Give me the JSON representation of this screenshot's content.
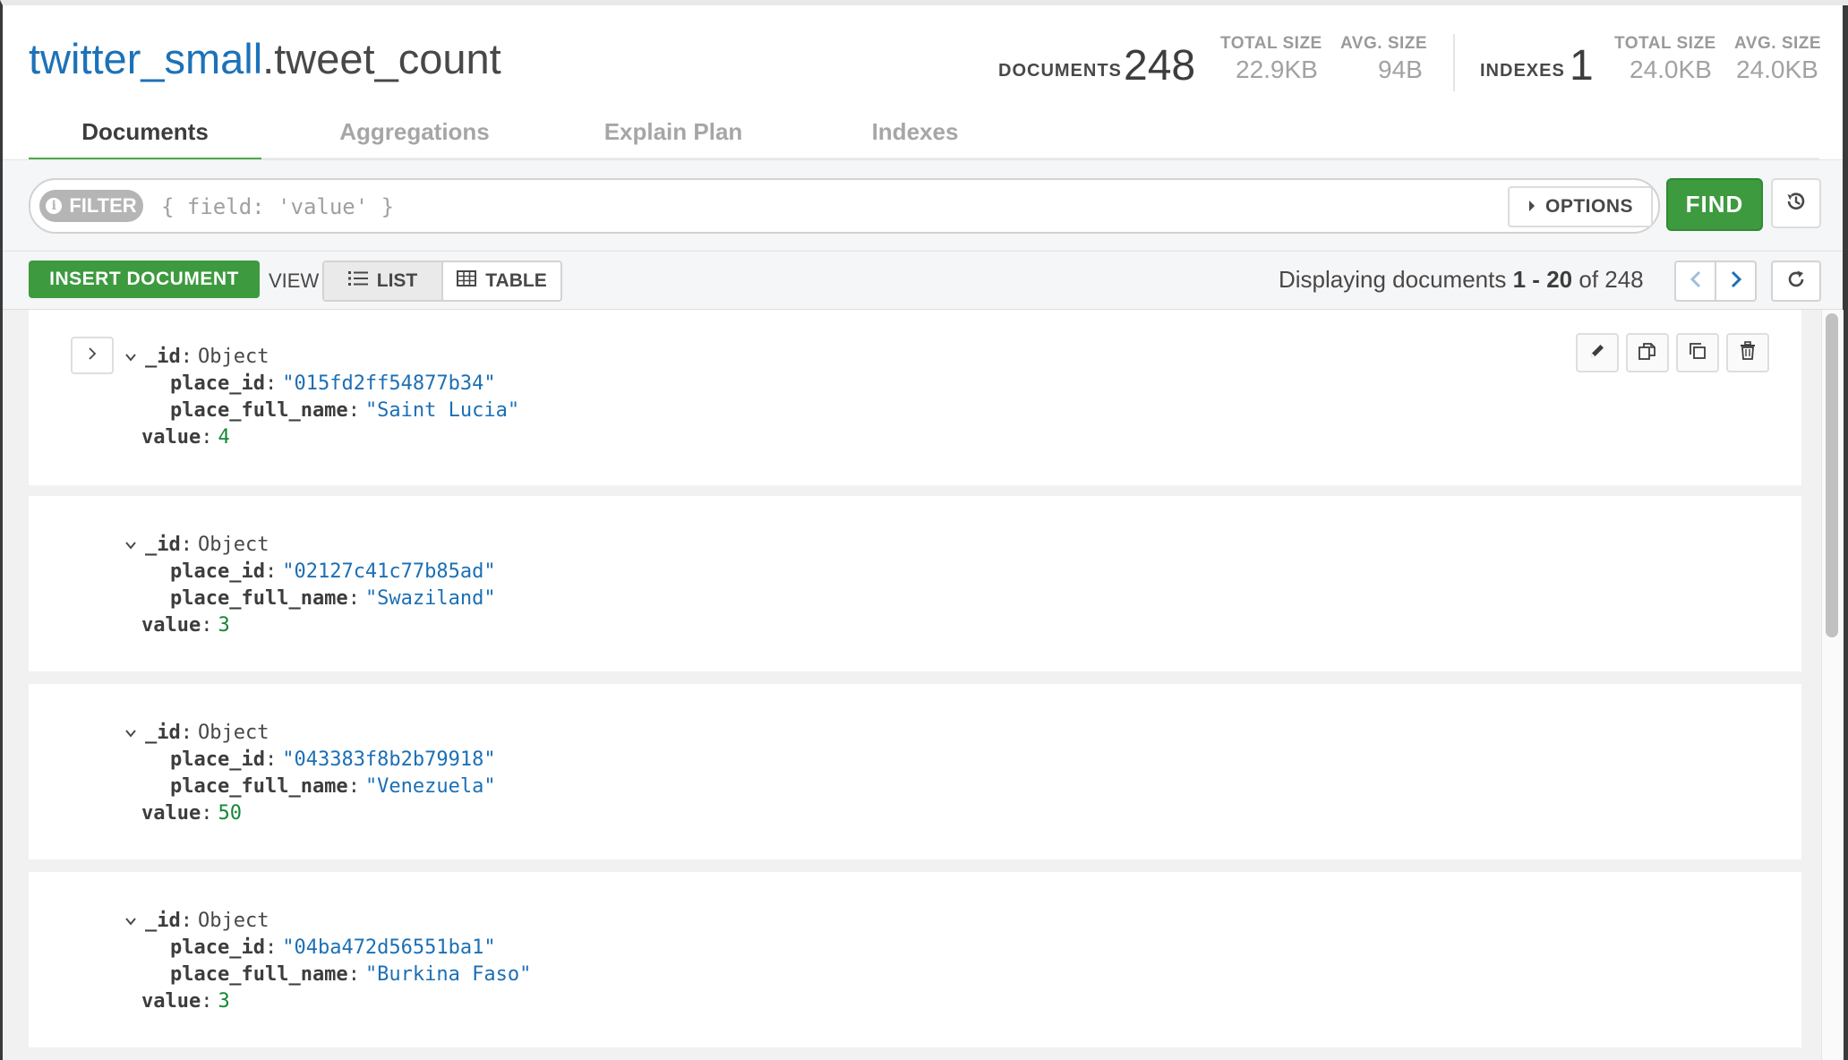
{
  "header": {
    "db_name": "twitter_small",
    "collection_name": ".tweet_count",
    "documents_label": "DOCUMENTS",
    "documents_count": "248",
    "doc_total_size_label": "TOTAL SIZE",
    "doc_total_size": "22.9KB",
    "doc_avg_size_label": "AVG. SIZE",
    "doc_avg_size": "94B",
    "indexes_label": "INDEXES",
    "indexes_count": "1",
    "idx_total_size_label": "TOTAL SIZE",
    "idx_total_size": "24.0KB",
    "idx_avg_size_label": "AVG. SIZE",
    "idx_avg_size": "24.0KB"
  },
  "tabs": [
    {
      "label": "Documents",
      "active": true
    },
    {
      "label": "Aggregations",
      "active": false
    },
    {
      "label": "Explain Plan",
      "active": false
    },
    {
      "label": "Indexes",
      "active": false
    }
  ],
  "query": {
    "filter_label": "FILTER",
    "filter_placeholder": "{ field: 'value' }",
    "options_label": "OPTIONS",
    "find_label": "FIND"
  },
  "toolbar": {
    "insert_label": "INSERT DOCUMENT",
    "view_label": "VIEW",
    "list_label": "LIST",
    "table_label": "TABLE",
    "display_prefix": "Displaying documents",
    "range_start": "1",
    "range_sep": "-",
    "range_end": "20",
    "of_text": "of 248"
  },
  "documents": [
    {
      "id_key": "_id",
      "id_type": "Object",
      "place_id_key": "place_id",
      "place_id": "\"015fd2ff54877b34\"",
      "name_key": "place_full_name",
      "name": "\"Saint Lucia\"",
      "value_key": "value",
      "value": "4"
    },
    {
      "id_key": "_id",
      "id_type": "Object",
      "place_id_key": "place_id",
      "place_id": "\"02127c41c77b85ad\"",
      "name_key": "place_full_name",
      "name": "\"Swaziland\"",
      "value_key": "value",
      "value": "3"
    },
    {
      "id_key": "_id",
      "id_type": "Object",
      "place_id_key": "place_id",
      "place_id": "\"043383f8b2b79918\"",
      "name_key": "place_full_name",
      "name": "\"Venezuela\"",
      "value_key": "value",
      "value": "50"
    },
    {
      "id_key": "_id",
      "id_type": "Object",
      "place_id_key": "place_id",
      "place_id": "\"04ba472d56551ba1\"",
      "name_key": "place_full_name",
      "name": "\"Burkina Faso\"",
      "value_key": "value",
      "value": "3"
    }
  ],
  "icons": {
    "info": "info-icon",
    "options_caret": "caret-right-icon",
    "history": "history-icon",
    "list": "list-icon",
    "table": "table-icon",
    "prev": "chevron-left-icon",
    "next": "chevron-right-icon",
    "refresh": "refresh-icon",
    "expand": "chevron-right-icon",
    "collapse": "chevron-down-icon",
    "edit": "pencil-icon",
    "copy": "copy-icon",
    "clone": "clone-icon",
    "delete": "trash-icon"
  },
  "colors": {
    "accent_green": "#3d9a3f",
    "db_blue": "#1c72b8",
    "string_blue": "#1c6fb5",
    "number_green": "#158734"
  }
}
